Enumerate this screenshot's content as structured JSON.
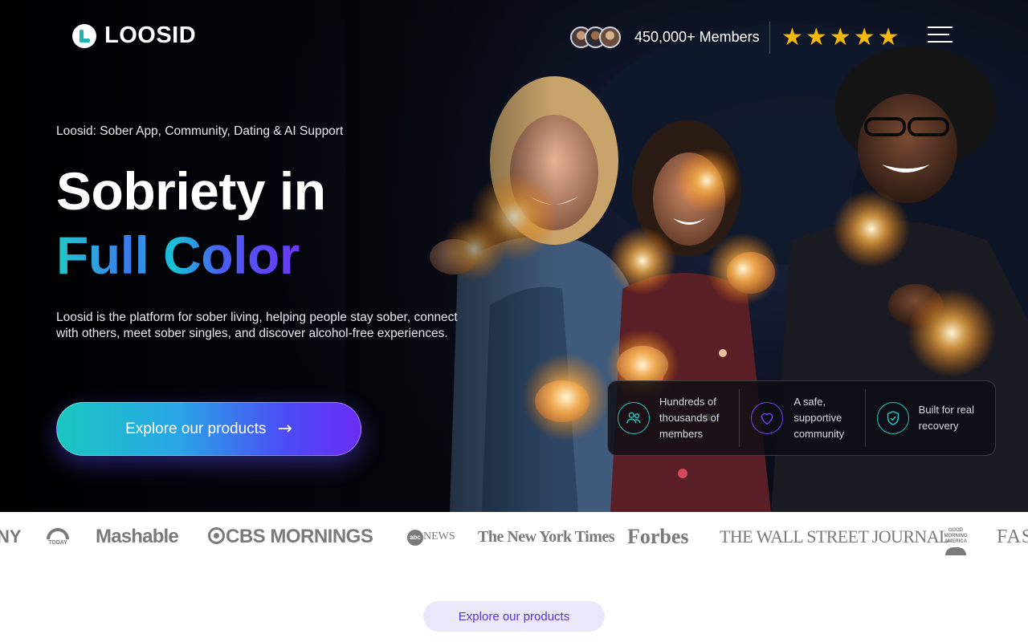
{
  "brand": {
    "name": "LOOSID"
  },
  "header": {
    "members_text": "450,000+ Members",
    "rating_stars": 5,
    "star_glyph": "★",
    "star_color": "#f5b90a",
    "menu_icon": "hamburger-icon"
  },
  "hero": {
    "eyebrow": "Loosid: Sober App, Community, Dating & AI Support",
    "title_line1": "Sobriety in",
    "title_line2": "Full Color",
    "description": "Loosid is the platform for sober living, helping people stay sober, connect with others, meet sober singles, and discover alcohol-free experiences.",
    "cta_label": "Explore our products",
    "cta_icon": "arrow-right-icon",
    "cta_arrow": "→",
    "gradient_colors": [
      "#18c7c1",
      "#2aa5e6",
      "#4b4cf5",
      "#6a2cf5"
    ]
  },
  "features": [
    {
      "icon": "people-icon",
      "text": "Hundreds of thousands of members"
    },
    {
      "icon": "heart-icon",
      "text": "A safe, supportive community"
    },
    {
      "icon": "shield-check-icon",
      "text": "Built for real recovery"
    }
  ],
  "press": {
    "logos": [
      "NY",
      "TODAY",
      "Mashable",
      "CBS MORNINGS",
      "NEWS",
      "The New York Times",
      "Forbes",
      "THE WALL STREET JOURNAL",
      "GOOD MORNING AMERICA",
      "FAST"
    ],
    "abc_ball": "abc",
    "gma_line1": "GOOD",
    "gma_line2": "MORNING",
    "gma_line3": "AMERICA"
  },
  "section": {
    "pill_label": "Explore our products"
  },
  "colors": {
    "accent_teal": "#2bc3bd",
    "accent_purple": "#6a3ff0",
    "press_gray": "#7a7a7a"
  }
}
